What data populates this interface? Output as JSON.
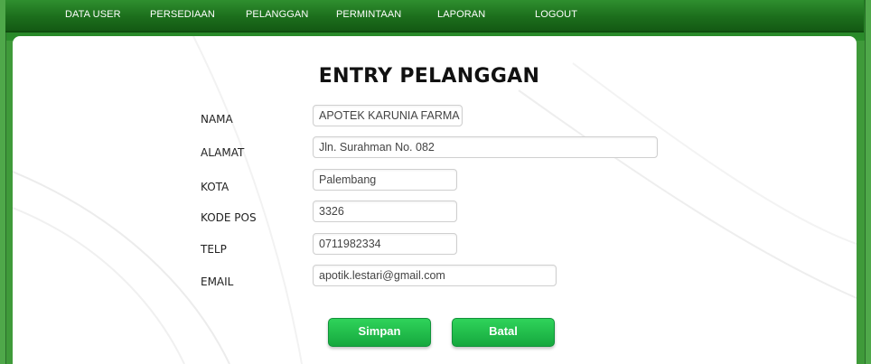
{
  "nav": {
    "items": [
      "DATA USER",
      "PERSEDIAAN",
      "PELANGGAN",
      "PERMINTAAN",
      "LAPORAN",
      "LOGOUT"
    ]
  },
  "form": {
    "title": "ENTRY PELANGGAN",
    "fields": [
      {
        "label": "NAMA",
        "value": "APOTEK KARUNIA FARMA"
      },
      {
        "label": "ALAMAT",
        "value": "Jln. Surahman No. 082"
      },
      {
        "label": "KOTA",
        "value": "Palembang"
      },
      {
        "label": "KODE POS",
        "value": "3326"
      },
      {
        "label": "TELP",
        "value": "0711982334"
      },
      {
        "label": "EMAIL",
        "value": "apotik.lestari@gmail.com"
      }
    ],
    "save_label": "Simpan",
    "cancel_label": "Batal"
  },
  "colors": {
    "nav_green": "#1c6e1c",
    "frame_green": "#3f9a3a",
    "button_green": "#16a83e"
  }
}
